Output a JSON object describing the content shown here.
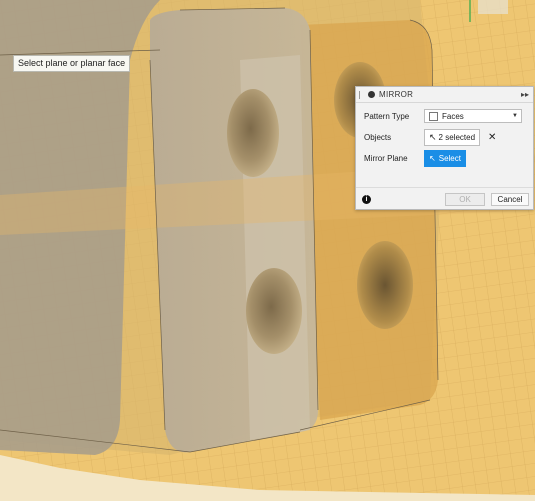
{
  "tooltip": {
    "text": "Select plane or planar face"
  },
  "panel": {
    "title": "MIRROR",
    "fields": {
      "pattern_type_label": "Pattern Type",
      "pattern_type_value": "Faces",
      "objects_label": "Objects",
      "objects_value": "2 selected",
      "mirror_plane_label": "Mirror Plane",
      "mirror_plane_button": "Select"
    },
    "buttons": {
      "ok": "OK",
      "cancel": "Cancel"
    }
  },
  "colors": {
    "accent": "#1a8ee6",
    "canvas": "#e8c070",
    "model_body": "#b6a78e"
  },
  "icons": [
    "expand-icon",
    "checkbox-icon",
    "dropdown-caret-icon",
    "cursor-icon",
    "clear-icon",
    "info-icon"
  ]
}
